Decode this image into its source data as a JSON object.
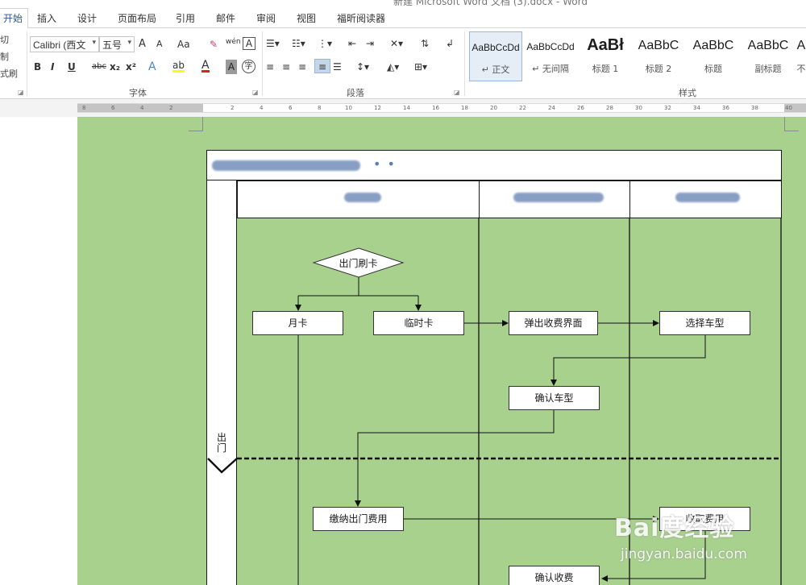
{
  "window": {
    "title": "新建 Microsoft Word 文档 (3).docx - Word"
  },
  "tabs": [
    "开始",
    "插入",
    "设计",
    "页面布局",
    "引用",
    "邮件",
    "审阅",
    "视图",
    "福昕阅读器"
  ],
  "clipboard": {
    "cut": "切",
    "copy": "制",
    "format_painter": "式刷"
  },
  "font": {
    "group_label": "字体",
    "font_name": "Calibri (西文",
    "font_size": "五号",
    "grow_label": "A",
    "shrink_label": "A",
    "case_label": "Aa",
    "phonetic_label": "wén",
    "border_char_label": "A",
    "bold": "B",
    "italic": "I",
    "underline": "U",
    "strike": "abc",
    "subscript": "x₂",
    "superscript": "x²",
    "effects_label": "A",
    "highlight_label": "ab",
    "color_label": "A",
    "shading_label": "A",
    "enclose_label": "字"
  },
  "paragraph": {
    "group_label": "段落"
  },
  "styles": {
    "group_label": "样式",
    "items": [
      {
        "sample": "AaBbCcDd",
        "name": "↵ 正文",
        "size": "12"
      },
      {
        "sample": "AaBbCcDd",
        "name": "↵ 无间隔",
        "size": "12"
      },
      {
        "sample": "AaBł",
        "name": "标题 1",
        "size": "20"
      },
      {
        "sample": "AaBbC",
        "name": "标题 2",
        "size": "16"
      },
      {
        "sample": "AaBbC",
        "name": "标题",
        "size": "16"
      },
      {
        "sample": "AaBbC",
        "name": "副标题",
        "size": "16"
      },
      {
        "sample": "A",
        "name": "不",
        "size": "16"
      }
    ]
  },
  "ruler": {
    "ticks": [
      "8",
      "6",
      "4",
      "2",
      "",
      "2",
      "4",
      "6",
      "8",
      "10",
      "12",
      "14",
      "16",
      "18",
      "20",
      "22",
      "24",
      "26",
      "28",
      "30",
      "32",
      "34",
      "36",
      "38",
      "40"
    ]
  },
  "flowchart": {
    "lanes": [
      "",
      "",
      ""
    ],
    "phase_label": "出门",
    "nodes": {
      "swipe": "出门刷卡",
      "monthly": "月卡",
      "temp": "临时卡",
      "popup": "弹出收费界面",
      "select_type": "选择车型",
      "confirm_type": "确认车型",
      "pay": "缴纳出门费用",
      "collect": "收取费用",
      "confirm_collect": "确认收费"
    }
  },
  "watermark": {
    "brand": "Bai度经验",
    "url": "jingyan.baidu.com"
  },
  "colors": {
    "page_bg": "#a8d18d",
    "accent": "#2b579a",
    "redaction": "#7c95bd"
  }
}
